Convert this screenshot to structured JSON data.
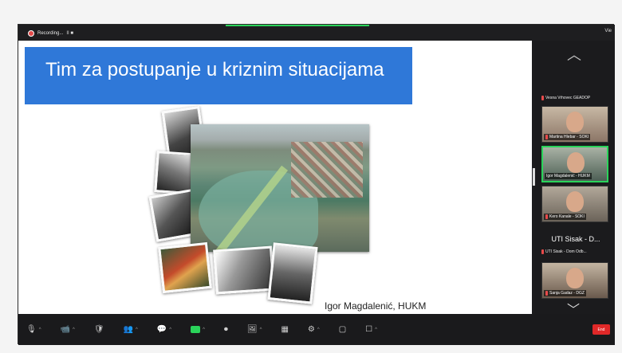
{
  "topbar": {
    "recording_label": "Recording...",
    "recording_controls": "II ■",
    "view_label": "Vie"
  },
  "slide": {
    "title": "Tim za postupanje u kriznim situacijama",
    "author": "Igor Magdalenić, HUKM"
  },
  "participants": {
    "name_only": "Vesna Vrhovec GEADOP",
    "tiles": [
      {
        "label": "Martina Hlebar - SOKI"
      },
      {
        "label": "Igor Magdalenić - HUKM"
      },
      {
        "label": "Kero Kanale - SOKI"
      },
      {
        "label": "Sanja Gadaz - DGZ"
      }
    ],
    "big_name": "UTI Sisak - D...",
    "small_name": "UTI Sisak - Dom Odb..."
  },
  "toolbar": {
    "buttons": [
      "🎙",
      "📹",
      "🛡",
      "👥",
      "💬",
      "⬆",
      "⏺",
      "🖼",
      "▦",
      "⚙",
      "▢",
      "☐"
    ],
    "end_label": "End"
  },
  "colors": {
    "title_bg": "#2f78d8",
    "accent_green": "#2ad35a",
    "end_red": "#e02828"
  }
}
